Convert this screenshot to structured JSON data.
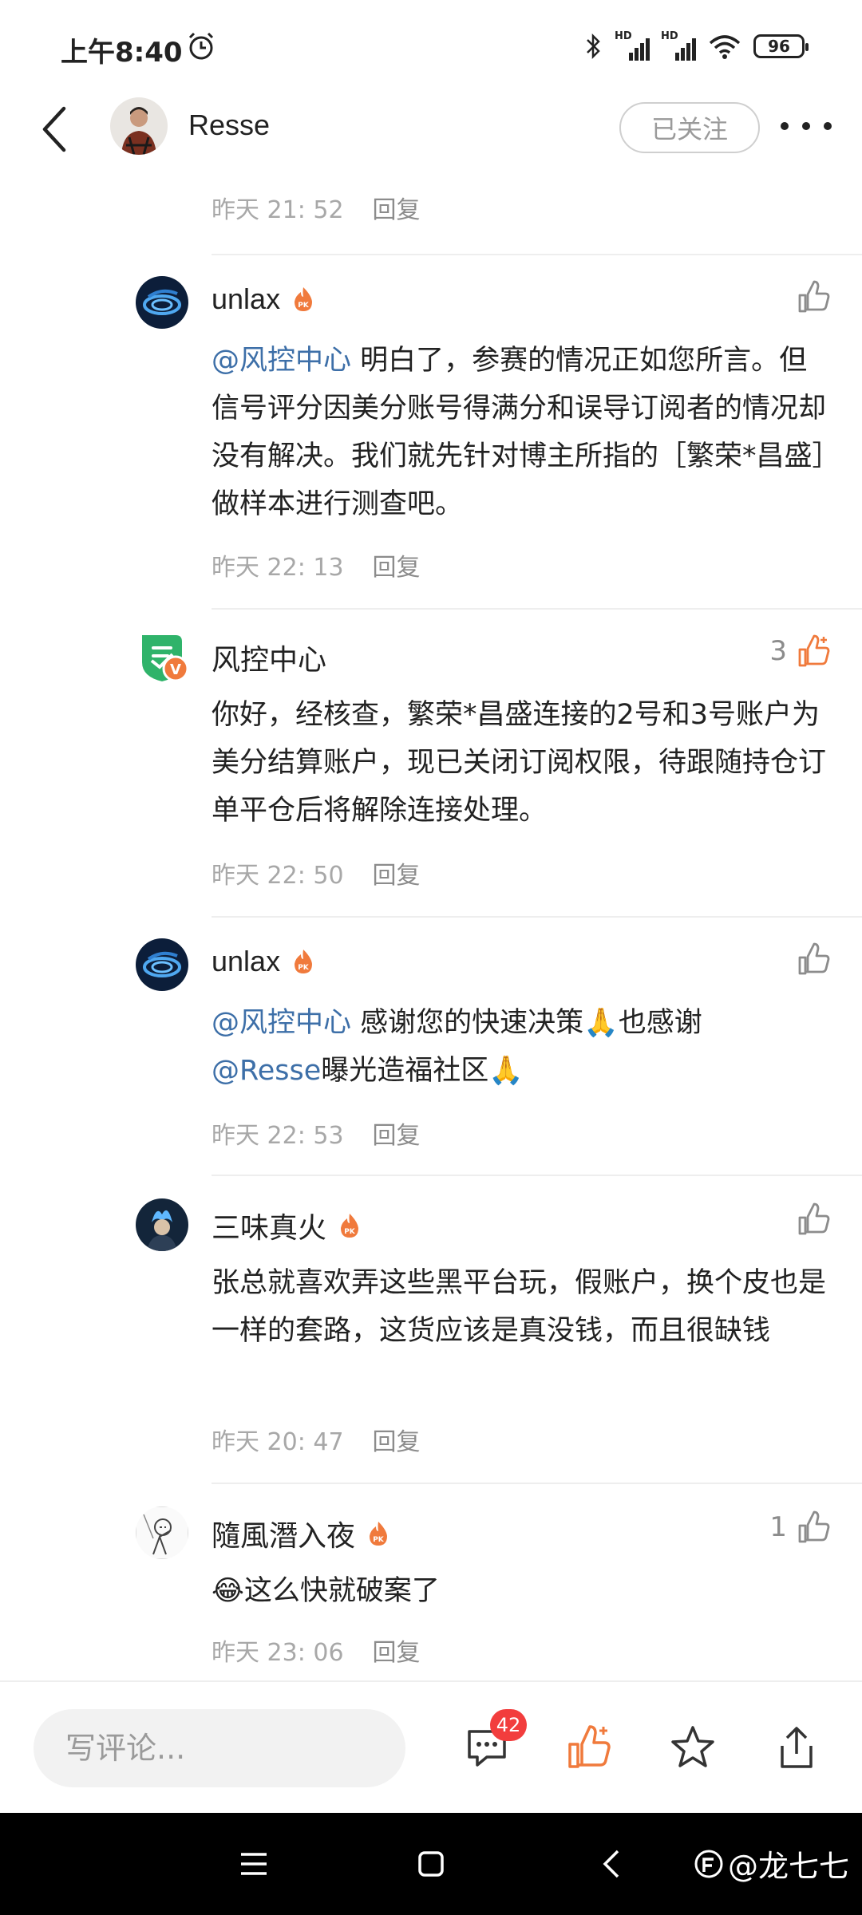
{
  "status_bar": {
    "time": "上午8:40",
    "signal1_label": "HD",
    "signal2_label": "HD",
    "battery": "96"
  },
  "header": {
    "name": "Resse",
    "follow_label": "已关注"
  },
  "top_meta": {
    "time": "昨天 21: 52",
    "reply": "回复"
  },
  "comments": [
    {
      "author": "unlax",
      "mention": "@风控中心",
      "text": " 明白了，参赛的情况正如您所言。但信号评分因美分账号得满分和误导订阅者的情况却没有解决。我们就先针对博主所指的［繁荣*昌盛］做样本进行测查吧。",
      "time": "昨天 22: 13",
      "reply": "回复",
      "likes": ""
    },
    {
      "author": "风控中心",
      "text": "你好，经核查，繁荣*昌盛连接的2号和3号账户为美分结算账户，现已关闭订阅权限，待跟随持仓订单平仓后将解除连接处理。",
      "time": "昨天 22: 50",
      "reply": "回复",
      "likes": "3"
    },
    {
      "author": "unlax",
      "mention": "@风控中心",
      "text_a": " 感谢您的快速决策🙏也感谢",
      "mention2": "@Resse",
      "text_b": "曝光造福社区🙏",
      "time": "昨天 22: 53",
      "reply": "回复",
      "likes": ""
    },
    {
      "author": "三味真火",
      "text": "张总就喜欢弄这些黑平台玩，假账户，换个皮也是一样的套路，这货应该是真没钱，而且很缺钱",
      "time": "昨天 20: 47",
      "reply": "回复",
      "likes": ""
    },
    {
      "author": "隨風潛入夜",
      "text": "😂这么快就破案了",
      "time": "昨天 23: 06",
      "reply": "回复",
      "likes": "1"
    }
  ],
  "action_bar": {
    "input_placeholder": "写评论...",
    "comment_count": "42"
  },
  "watermark": "@龙七七",
  "colors": {
    "accent_orange": "#f07a3c",
    "mention_blue": "#3d6fa8",
    "badge_red": "#f23d3d"
  }
}
